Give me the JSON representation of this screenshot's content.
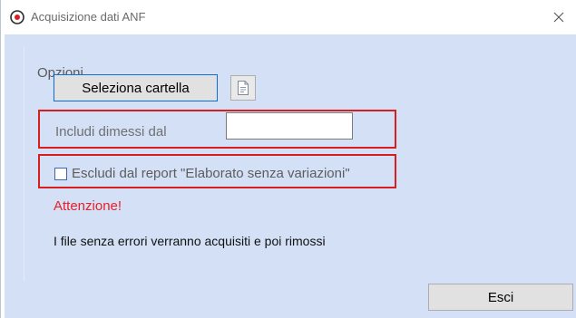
{
  "window": {
    "title": "Acquisizione dati ANF",
    "icon": "app-icon",
    "close_icon": "close-icon"
  },
  "options": {
    "group_title": "Opzioni",
    "select_folder_label": "Seleziona cartella",
    "doc_button_icon": "document-icon",
    "include_discharged_label": "Includi dimessi dal",
    "include_discharged_value": "",
    "exclude_checkbox_checked": false,
    "exclude_label": "Escludi dal report \"Elaborato senza variazioni\"",
    "warning_text": "Attenzione!",
    "info_text": "I file senza errori verranno acquisiti e poi rimossi"
  },
  "footer": {
    "exit_label": "Esci"
  },
  "colors": {
    "client_bg": "#d3e0f5",
    "highlight_border": "#d81e1e",
    "warning": "#e8202a",
    "focus_border": "#0a6fd6"
  }
}
